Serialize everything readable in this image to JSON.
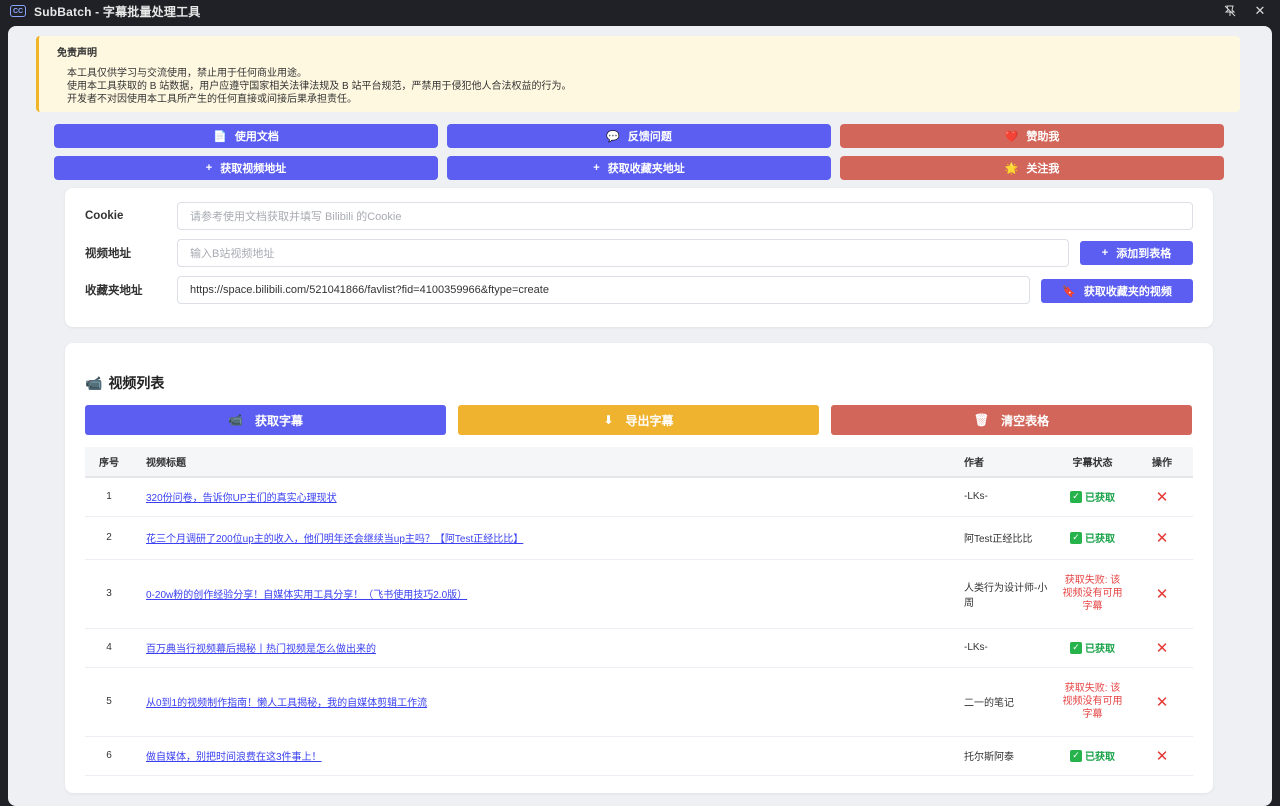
{
  "titlebar": {
    "icon_text": "CC",
    "title": "SubBatch - 字幕批量处理工具",
    "pin_icon": "pin-off-icon",
    "close_icon": "close-icon"
  },
  "disclaimer": {
    "title": "免责声明",
    "lines": [
      "本工具仅供学习与交流使用，禁止用于任何商业用途。",
      "使用本工具获取的 B 站数据，用户应遵守国家相关法律法规及 B 站平台规范，严禁用于侵犯他人合法权益的行为。",
      "开发者不对因使用本工具所产生的任何直接或间接后果承担责任。"
    ]
  },
  "buttons": {
    "docs": {
      "icon": "📄",
      "label": "使用文档"
    },
    "feedback": {
      "icon": "💬",
      "label": "反馈问题"
    },
    "sponsor": {
      "icon": "❤️",
      "label": "赞助我"
    },
    "get_video_url": {
      "icon": "+",
      "label": "获取视频地址"
    },
    "get_fav_url": {
      "icon": "+",
      "label": "获取收藏夹地址"
    },
    "follow": {
      "icon": "🌟",
      "label": "关注我"
    }
  },
  "form": {
    "cookie": {
      "label": "Cookie",
      "placeholder": "请参考使用文档获取并填写 Bilibili 的Cookie",
      "value": ""
    },
    "video_url": {
      "label": "视频地址",
      "placeholder": "输入B站视频地址",
      "value": ""
    },
    "add_button": {
      "icon": "+",
      "label": "添加到表格"
    },
    "fav_url": {
      "label": "收藏夹地址",
      "value": "https://space.bilibili.com/521041866/favlist?fid=4100359966&ftype=create"
    },
    "fetch_fav_button": {
      "icon": "🔖",
      "label": "获取收藏夹的视频"
    }
  },
  "list": {
    "icon": "📹",
    "title": "视频列表",
    "fetch_btn": {
      "icon": "📹",
      "label": "获取字幕"
    },
    "export_btn": {
      "icon": "⬇",
      "label": "导出字幕"
    },
    "clear_btn": {
      "icon": "🗑",
      "label": "清空表格"
    },
    "columns": {
      "idx": "序号",
      "title": "视频标题",
      "author": "作者",
      "status": "字幕状态",
      "op": "操作"
    },
    "rows": [
      {
        "idx": "1",
        "title": "320份问卷，告诉你UP主们的真实心理现状",
        "author": "-LKs-",
        "status": "已获取",
        "ok": true
      },
      {
        "idx": "2",
        "title": "花三个月调研了200位up主的收入，他们明年还会继续当up主吗？【阿Test正经比比】",
        "author": "阿Test正经比比",
        "status": "已获取",
        "ok": true
      },
      {
        "idx": "3",
        "title": "0-20w粉的创作经验分享！自媒体实用工具分享！（飞书使用技巧2.0版）",
        "author": "人类行为设计师-小周",
        "status": "获取失败: 该视频没有可用字幕",
        "ok": false
      },
      {
        "idx": "4",
        "title": "百万典当行视频幕后揭秘丨热门视频是怎么做出来的",
        "author": "-LKs-",
        "status": "已获取",
        "ok": true
      },
      {
        "idx": "5",
        "title": "从0到1的视频制作指南！懒人工具揭秘，我的自媒体剪辑工作流",
        "author": "二一的笔记",
        "status": "获取失败: 该视频没有可用字幕",
        "ok": false
      },
      {
        "idx": "6",
        "title": "做自媒体，别把时间浪费在这3件事上！",
        "author": "托尔斯阿泰",
        "status": "已获取",
        "ok": true
      }
    ],
    "delete_icon": "✕"
  },
  "colors": {
    "primary": "#5b5ef0",
    "danger": "#d2665a",
    "warning": "#efb32f",
    "success": "#1aa34a",
    "error": "#e54545"
  }
}
